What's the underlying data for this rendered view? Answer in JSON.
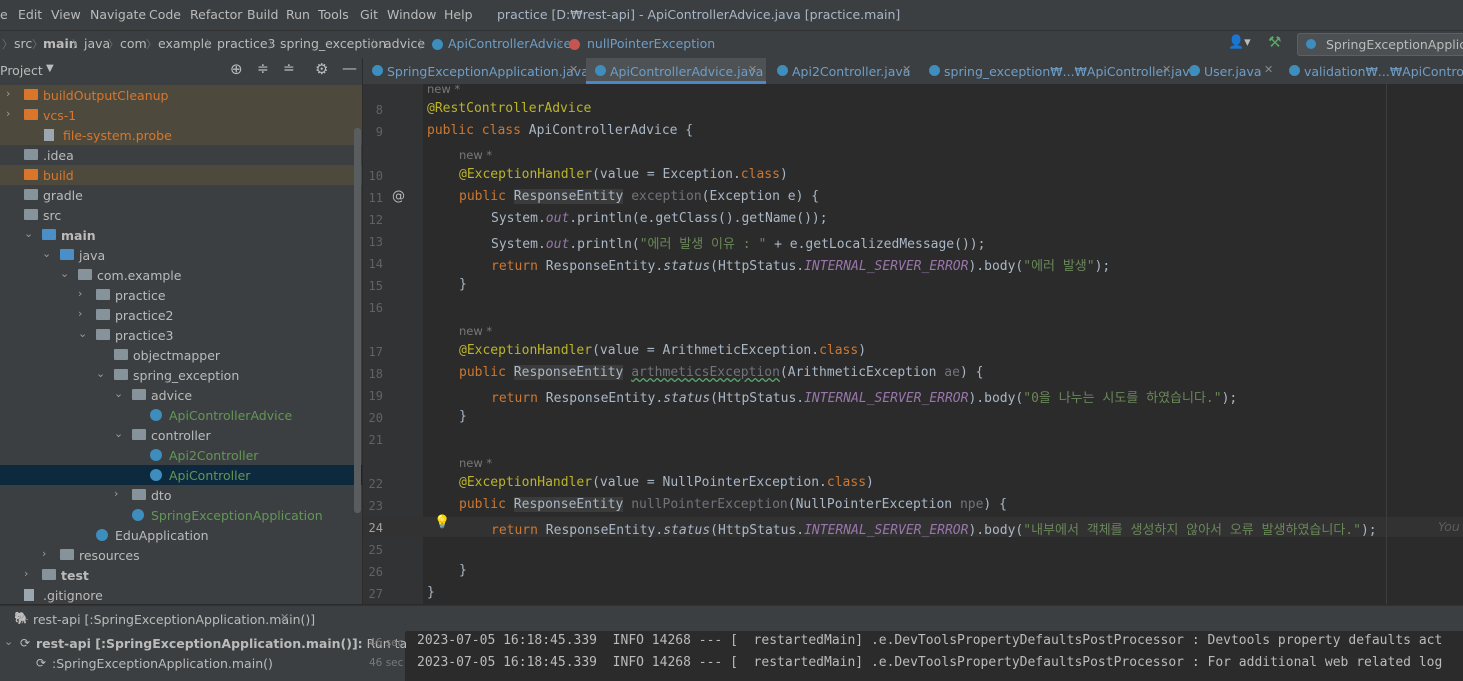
{
  "menubar": {
    "items": [
      "e",
      "Edit",
      "View",
      "Navigate",
      "Code",
      "Refactor",
      "Build",
      "Run",
      "Tools",
      "Git",
      "Window",
      "Help"
    ],
    "title": "practice [D:₩rest-api] - ApiControllerAdvice.java [practice.main]"
  },
  "breadcrumb": {
    "items": [
      "src",
      "main",
      "java",
      "com",
      "example",
      "practice3",
      "spring_exception",
      "advice"
    ],
    "class_name": "ApiControllerAdvice",
    "method_name": "nullPointerException",
    "run_config": "SpringExceptionApplicatio"
  },
  "project_panel": {
    "title": "Project"
  },
  "tree": [
    {
      "label": "buildOutputCleanup",
      "color": "#d9762b"
    },
    {
      "label": "vcs-1",
      "color": "#d9762b"
    },
    {
      "label": "file-system.probe",
      "color": "#d9762b"
    },
    {
      "label": ".idea",
      "color": "#bbbbbb"
    },
    {
      "label": "build",
      "color": "#d9762b"
    },
    {
      "label": "gradle",
      "color": "#bbbbbb"
    },
    {
      "label": "src",
      "color": "#bbbbbb"
    },
    {
      "label": "main",
      "color": "#bbbbbb"
    },
    {
      "label": "java",
      "color": "#bbbbbb"
    },
    {
      "label": "com.example",
      "color": "#bbbbbb"
    },
    {
      "label": "practice",
      "color": "#bbbbbb"
    },
    {
      "label": "practice2",
      "color": "#bbbbbb"
    },
    {
      "label": "practice3",
      "color": "#bbbbbb"
    },
    {
      "label": "objectmapper",
      "color": "#bbbbbb"
    },
    {
      "label": "spring_exception",
      "color": "#bbbbbb"
    },
    {
      "label": "advice",
      "color": "#bbbbbb"
    },
    {
      "label": "ApiControllerAdvice",
      "color": "#629755"
    },
    {
      "label": "controller",
      "color": "#bbbbbb"
    },
    {
      "label": "Api2Controller",
      "color": "#629755"
    },
    {
      "label": "ApiController",
      "color": "#629755"
    },
    {
      "label": "dto",
      "color": "#bbbbbb"
    },
    {
      "label": "SpringExceptionApplication",
      "color": "#629755"
    },
    {
      "label": "EduApplication",
      "color": "#bbbbbb"
    },
    {
      "label": "resources",
      "color": "#bbbbbb"
    },
    {
      "label": "test",
      "color": "#bbbbbb"
    },
    {
      "label": ".gitignore",
      "color": "#bbbbbb"
    }
  ],
  "editor_tabs": [
    {
      "label": "SpringExceptionApplication.java"
    },
    {
      "label": "ApiControllerAdvice.java"
    },
    {
      "label": "Api2Controller.java"
    },
    {
      "label": "spring_exception₩...₩ApiController.java"
    },
    {
      "label": "User.java"
    },
    {
      "label": "validation₩...₩ApiController.java"
    }
  ],
  "code": {
    "hint_new": "new *",
    "line_numbers": [
      "8",
      "9",
      "10",
      "11",
      "12",
      "13",
      "14",
      "15",
      "16",
      "17",
      "18",
      "19",
      "20",
      "21",
      "22",
      "23",
      "24",
      "25",
      "26",
      "27"
    ],
    "annotation": "@RestControllerAdvice",
    "kw_public": "public",
    "kw_class": "class",
    "kw_return": "return",
    "kw_dotclass": "class",
    "class_decl": "ApiControllerAdvice {",
    "exh": "@ExceptionHandler",
    "value_eq": "(value = ",
    "exception_cls": "Exception.",
    "arith_cls": "ArithmeticException.",
    "npe_cls": "NullPointerException.",
    "close_paren": ")",
    "response_entity": "ResponseEntity",
    "m1_name": "exception",
    "m1_params": "(Exception e) {",
    "m2_name": "arthmeticsException",
    "m2_params_a": "(ArithmeticException ",
    "m2_param_name": "ae",
    "m2_params_b": ") {",
    "m3_name": "nullPointerException",
    "m3_params_a": "(NullPointerException ",
    "m3_param_name": "npe",
    "m3_params_b": ") {",
    "sys": "System.",
    "out": "out",
    "println_a": ".println(e.getClass().getName());",
    "println_b": ".println(",
    "str_err_reason": "\"에러 발생 이유 : \"",
    "concat_msg": " + e.getLocalizedMessage());",
    "resp_status": "ResponseEntity.",
    "status": "status",
    "http_status": "(HttpStatus.",
    "ise": "INTERNAL_SERVER_ERROR",
    "body": ").body(",
    "str1": "\"에러 발생\"",
    "str2": "\"0을 나누는 시도를 하였습니다.\"",
    "str3": "\"내부에서 객체를 생성하지 않아서 오류 발생하였습니다.\"",
    "end_stmt": ");",
    "rbrace": "}",
    "inlay_you": "You"
  },
  "run_panel": {
    "tab_label": "rest-api [:SpringExceptionApplication.main()]",
    "root_label": "rest-api [:SpringExceptionApplication.main()]:",
    "root_suffix": " Run tasks...",
    "root_time": "46 sec",
    "child_label": ":SpringExceptionApplication.main()",
    "child_time": "46 sec"
  },
  "console": {
    "lines": [
      "2023-07-05 16:18:45.339  INFO 14268 --- [  restartedMain] .e.DevToolsPropertyDefaultsPostProcessor : Devtools property defaults act",
      "2023-07-05 16:18:45.339  INFO 14268 --- [  restartedMain] .e.DevToolsPropertyDefaultsPostProcessor : For additional web related log"
    ]
  }
}
